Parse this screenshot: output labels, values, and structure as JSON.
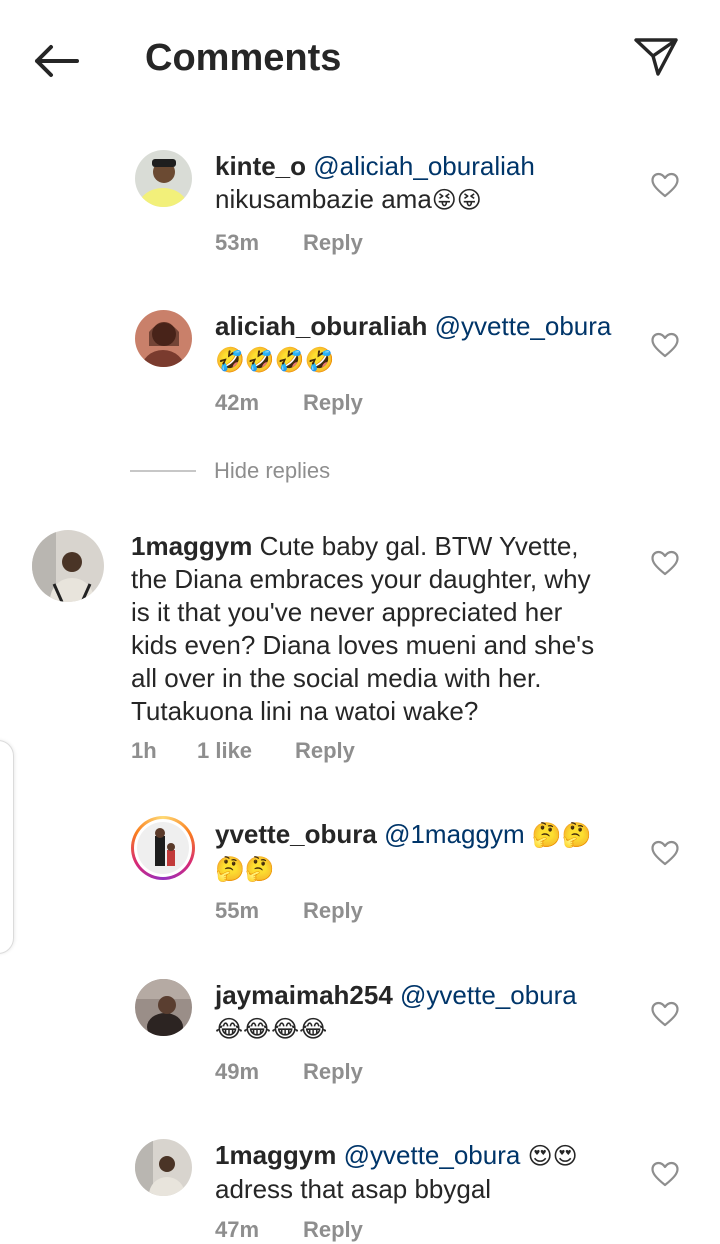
{
  "header": {
    "title": "Comments",
    "back_icon": "arrow-left-icon",
    "share_icon": "paper-plane-icon"
  },
  "hide_replies_label": "Hide replies",
  "comments": [
    {
      "username": "kinte_o",
      "mention": "@aliciah_oburaliah",
      "text": "nikusambazie ama",
      "emoji": "😝😝",
      "time": "53m",
      "likes": "",
      "reply_label": "Reply"
    },
    {
      "username": "aliciah_oburaliah",
      "mention": "@yvette_obura",
      "text": "",
      "emoji": "🤣🤣🤣🤣",
      "time": "42m",
      "likes": "",
      "reply_label": "Reply"
    },
    {
      "username": "1maggym",
      "mention": "",
      "text_line1": " Cute baby gal.  BTW Yvette,",
      "text_line2": "the Diana embraces your daughter, why",
      "text_line3": "is it that you've never appreciated her",
      "text_line4": "kids even? Diana loves mueni and she's",
      "text_line5": "all over in the social media with her.",
      "text_line6": "Tutakuona lini na watoi wake?",
      "time": "1h",
      "likes": "1 like",
      "reply_label": "Reply"
    },
    {
      "username": "yvette_obura",
      "mention": "@1maggym",
      "emoji_line1": "🤔🤔",
      "emoji_line2": "🤔🤔",
      "time": "55m",
      "likes": "",
      "reply_label": "Reply"
    },
    {
      "username": "jaymaimah254",
      "mention": "@yvette_obura",
      "emoji": "😂😂😂😂",
      "time": "49m",
      "likes": "",
      "reply_label": "Reply"
    },
    {
      "username": "1maggym",
      "mention": "@yvette_obura",
      "emoji": "😍😍",
      "text": "adress that asap bbygal",
      "time": "47m",
      "likes": "",
      "reply_label": "Reply"
    }
  ],
  "colors": {
    "text": "#262626",
    "mention": "#003569",
    "meta": "#8e8e8e",
    "divider": "#c7c7c7"
  },
  "icons": {
    "like": "heart-outline-icon"
  }
}
